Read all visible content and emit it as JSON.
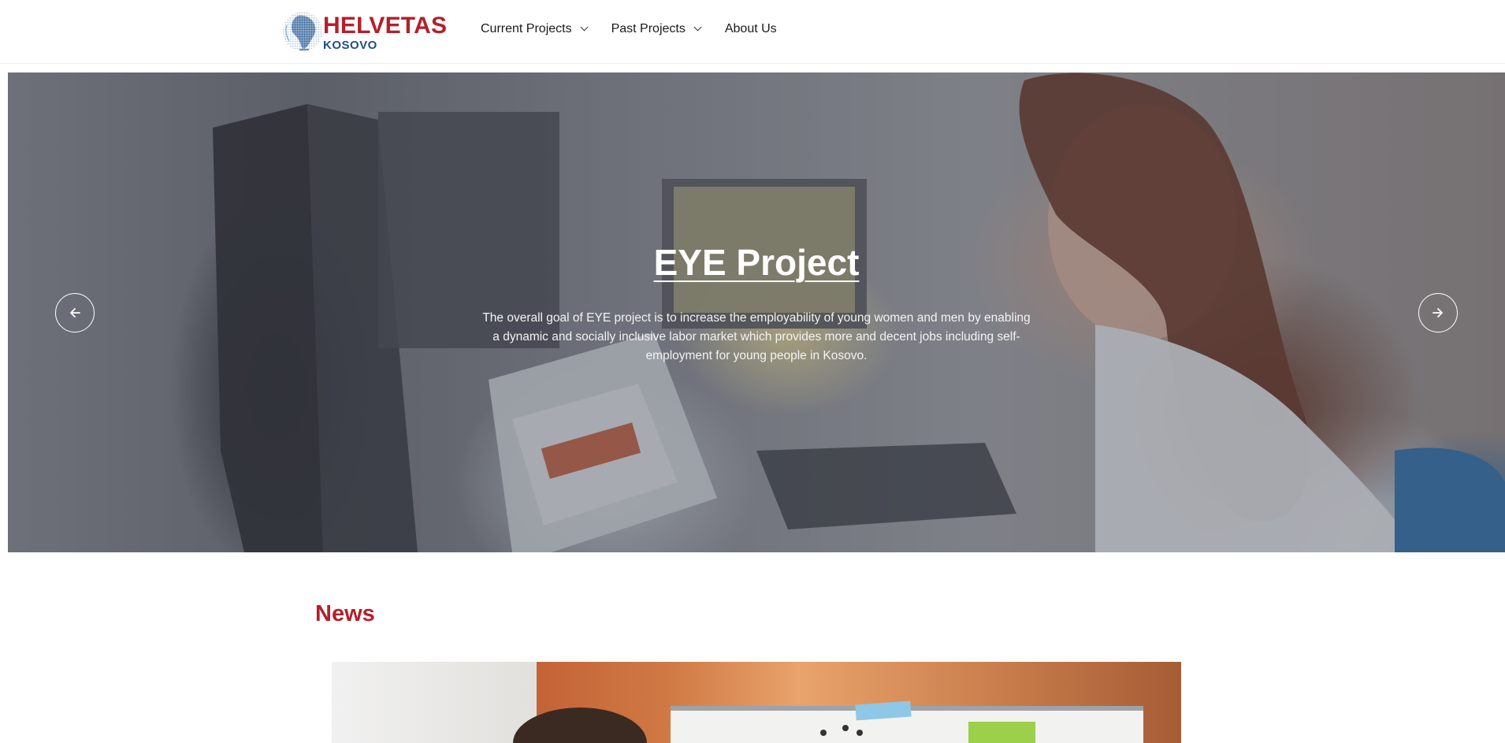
{
  "header": {
    "logo": {
      "name": "HELVETAS",
      "subtitle": "KOSOVO"
    },
    "nav": [
      {
        "label": "Current Projects",
        "has_dropdown": true
      },
      {
        "label": "Past Projects",
        "has_dropdown": true
      },
      {
        "label": "About Us",
        "has_dropdown": false
      }
    ]
  },
  "hero": {
    "title": "EYE Project",
    "description": "The overall goal of EYE project is to increase the employability of young women and men by enabling a dynamic and socially inclusive labor market which provides more and decent jobs including self-employment for young people in Kosovo.",
    "prev_icon": "arrow-left-icon",
    "next_icon": "arrow-right-icon"
  },
  "news": {
    "heading": "News"
  },
  "colors": {
    "brand_red": "#b3202a",
    "brand_blue": "#1c4f8a"
  }
}
